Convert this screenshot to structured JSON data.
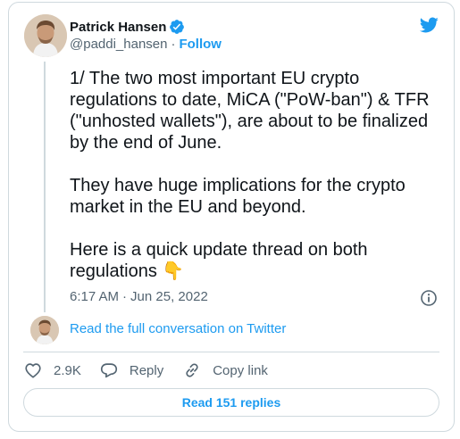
{
  "author": {
    "display_name": "Patrick Hansen",
    "handle": "@paddi_hansen",
    "separator": "·",
    "follow_label": "Follow"
  },
  "tweet": {
    "text": "1/ The two most important EU crypto regulations to date, MiCA (\"PoW-ban\") & TFR (\"unhosted wallets\"), are about to be finalized by the end of June.\n\nThey have huge implications for the crypto market in the EU and beyond.\n\nHere is a quick update thread on both regulations 👇",
    "time": "6:17 AM",
    "separator": "·",
    "date": "Jun 25, 2022"
  },
  "conversation": {
    "link_label": "Read the full conversation on Twitter"
  },
  "actions": {
    "like_count": "2.9K",
    "reply_label": "Reply",
    "copy_link_label": "Copy link"
  },
  "footer": {
    "read_replies_label": "Read 151 replies"
  },
  "icons": {
    "brand": "twitter-bird-icon",
    "verified": "verified-badge-icon",
    "info": "info-icon",
    "like": "heart-icon",
    "reply": "speech-bubble-icon",
    "copy": "link-icon"
  },
  "colors": {
    "accent": "#1d9bf0",
    "text": "#0f1419",
    "muted": "#536471",
    "border": "#cfd9de"
  }
}
